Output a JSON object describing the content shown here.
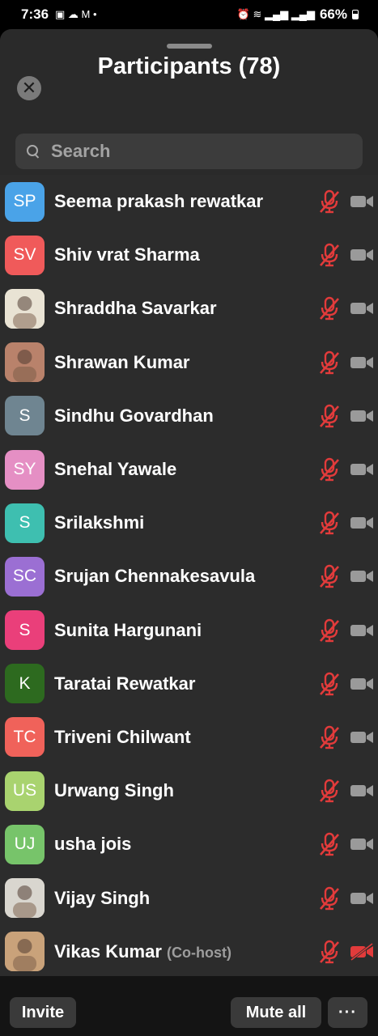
{
  "status_bar": {
    "time": "7:36",
    "battery": "66%"
  },
  "panel": {
    "title": "Participants (78)",
    "close_symbol": "✕",
    "search_placeholder": "Search"
  },
  "participants": [
    {
      "initials": "SP",
      "name": "Seema prakash rewatkar",
      "avatar_color": "#4aa3e8",
      "avatar_type": "initials",
      "mic": "muted",
      "video": "off"
    },
    {
      "initials": "SV",
      "name": "Shiv vrat Sharma",
      "avatar_color": "#f05a5a",
      "avatar_type": "initials",
      "mic": "muted",
      "video": "off"
    },
    {
      "initials": "",
      "name": "Shraddha Savarkar",
      "avatar_color": "#e9e3d4",
      "avatar_type": "photo",
      "mic": "muted",
      "video": "off"
    },
    {
      "initials": "",
      "name": "Shrawan Kumar",
      "avatar_color": "#b9826b",
      "avatar_type": "photo",
      "mic": "muted",
      "video": "off"
    },
    {
      "initials": "S",
      "name": "Sindhu Govardhan",
      "avatar_color": "#6f8591",
      "avatar_type": "initials",
      "mic": "muted",
      "video": "off"
    },
    {
      "initials": "SY",
      "name": "Snehal Yawale",
      "avatar_color": "#e58fc4",
      "avatar_type": "initials",
      "mic": "muted",
      "video": "off"
    },
    {
      "initials": "S",
      "name": "Srilakshmi",
      "avatar_color": "#3ebfb0",
      "avatar_type": "initials",
      "mic": "muted",
      "video": "off"
    },
    {
      "initials": "SC",
      "name": "Srujan Chennakesavula",
      "avatar_color": "#9b6fd3",
      "avatar_type": "initials",
      "mic": "muted",
      "video": "off"
    },
    {
      "initials": "S",
      "name": "Sunita Hargunani",
      "avatar_color": "#ea3f7a",
      "avatar_type": "initials",
      "mic": "muted",
      "video": "off"
    },
    {
      "initials": "K",
      "name": "Taratai Rewatkar",
      "avatar_color": "#2d6a1f",
      "avatar_type": "initials",
      "mic": "muted",
      "video": "off"
    },
    {
      "initials": "TC",
      "name": "Triveni Chilwant",
      "avatar_color": "#f0625a",
      "avatar_type": "initials",
      "mic": "muted",
      "video": "off"
    },
    {
      "initials": "US",
      "name": "Urwang Singh",
      "avatar_color": "#a9d36f",
      "avatar_type": "initials",
      "mic": "muted",
      "video": "off"
    },
    {
      "initials": "UJ",
      "name": "usha jois",
      "avatar_color": "#77c46a",
      "avatar_type": "initials",
      "mic": "muted",
      "video": "off"
    },
    {
      "initials": "",
      "name": "Vijay Singh",
      "avatar_color": "#d9d6cf",
      "avatar_type": "photo",
      "mic": "muted",
      "video": "off"
    },
    {
      "initials": "",
      "name": "Vikas Kumar",
      "role": "(Co-host)",
      "avatar_color": "#c9a27a",
      "avatar_type": "photo",
      "mic": "muted",
      "video": "off-red"
    }
  ],
  "footer": {
    "invite_label": "Invite",
    "mute_all_label": "Mute all",
    "more_label": "···"
  },
  "colors": {
    "muted_red": "#e23b3b",
    "video_grey": "#9a9a9a",
    "panel_bg": "#2c2c2c",
    "header_bg": "#2a2a2a"
  },
  "icons": [
    "close-icon",
    "search-icon",
    "mic-muted-icon",
    "video-off-icon",
    "more-icon"
  ]
}
